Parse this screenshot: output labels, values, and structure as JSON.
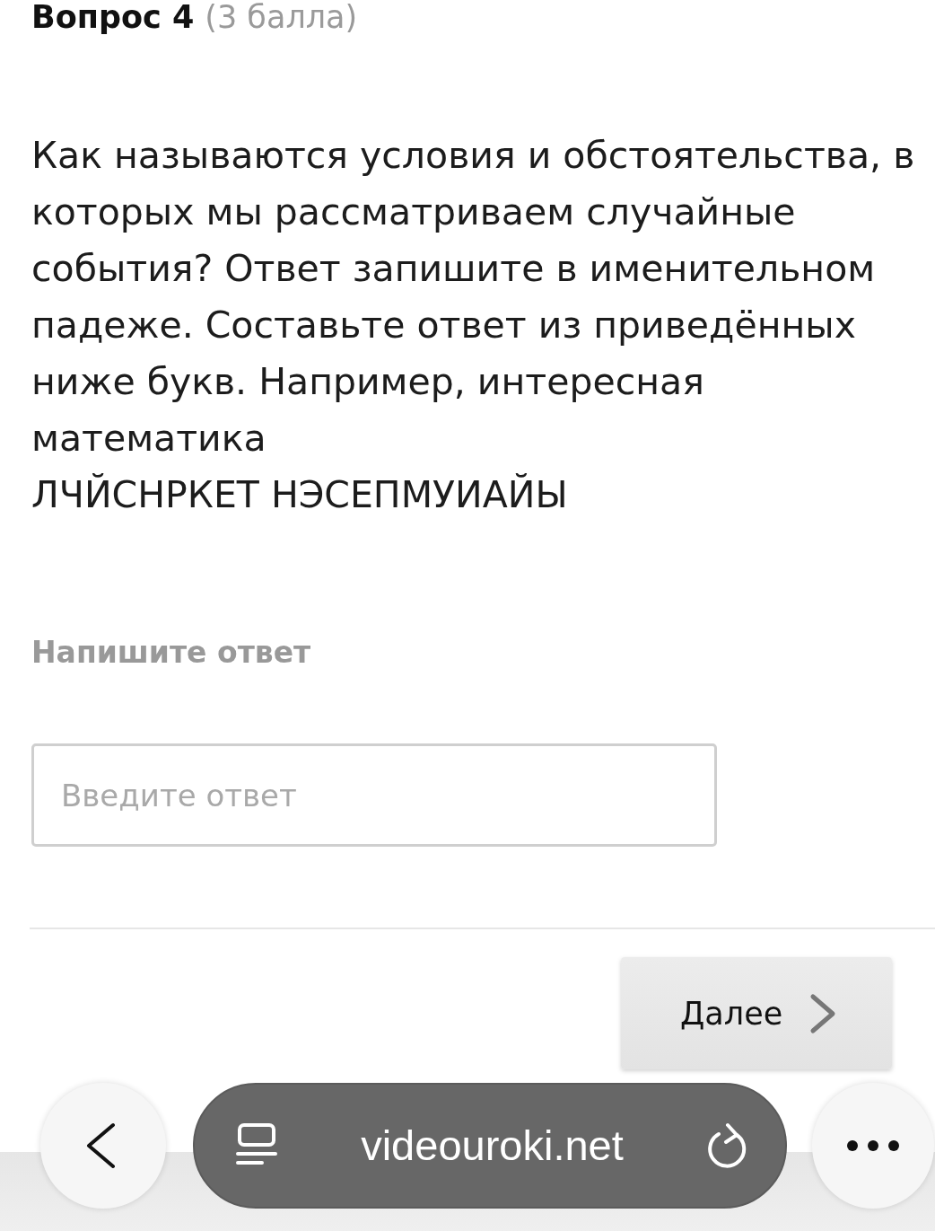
{
  "question": {
    "number_label": "Вопрос 4",
    "points": "(3 балла)",
    "text": "Как называются условия и обстоятельства, в которых мы рассматриваем случайные события? Ответ запишите в именительном падеже. Составьте ответ из приведённых ниже букв. Например, интересная математика",
    "letters": "ЛЧЙСНРКЕТ НЭСЕПМУИАЙЫ"
  },
  "answer": {
    "label": "Напишите ответ",
    "placeholder": "Введите ответ"
  },
  "next_button": {
    "label": "Далее"
  },
  "browser_bar": {
    "url": "videouroki.net"
  }
}
